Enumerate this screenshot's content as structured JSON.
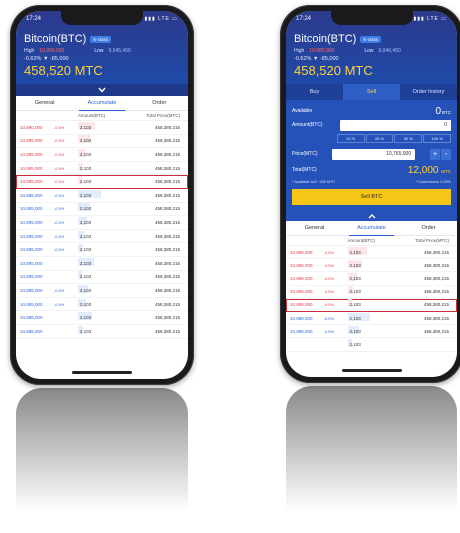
{
  "status": {
    "time": "17:24",
    "signal": "▮▮▮ LTE ▭"
  },
  "market": {
    "title": "Bitcoin(BTC)",
    "badge": "K-class",
    "high_label": "High",
    "low_label": "Low",
    "change": "-0.62% ▼ -85,000",
    "price": "458,520 MTC"
  },
  "left_phone": {
    "high_value": "10,990,000",
    "low_value": "9,945,450",
    "tabs": [
      "General",
      "Accumulate",
      "Order"
    ],
    "active_tab": 1,
    "columns": [
      "",
      "Amount(BTC)",
      "Total Price(MTC)"
    ],
    "rows": [
      {
        "side": "ask",
        "price": "10,890,000",
        "pct": "-0.5%",
        "amt": "2,103",
        "total": "458,380,215",
        "fill": 0.42
      },
      {
        "side": "ask",
        "price": "10,885,000",
        "pct": "-0.5%",
        "amt": "2,103",
        "total": "458,380,215",
        "fill": 0.3
      },
      {
        "side": "ask",
        "price": "10,885,000",
        "pct": "-0.5%",
        "amt": "2,103",
        "total": "458,380,215",
        "fill": 0.18
      },
      {
        "side": "ask",
        "price": "10,885,000",
        "pct": "-0.5%",
        "amt": "2,103",
        "total": "458,380,215",
        "fill": 0.12
      },
      {
        "side": "ask",
        "price": "10,885,000",
        "pct": "-0.5%",
        "amt": "2,103",
        "total": "458,380,215",
        "fill": 0.1,
        "selected": true
      },
      {
        "side": "bid",
        "price": "10,885,000",
        "pct": "-0.5%",
        "amt": "2,103",
        "total": "458,380,215",
        "fill": 0.55
      },
      {
        "side": "bid",
        "price": "10,885,000",
        "pct": "-0.5%",
        "amt": "2,103",
        "total": "458,380,215",
        "fill": 0.3
      },
      {
        "side": "bid",
        "price": "10,885,000",
        "pct": "-0.5%",
        "amt": "2,103",
        "total": "458,380,215",
        "fill": 0.22
      },
      {
        "side": "bid",
        "price": "10,885,000",
        "pct": "-0.5%",
        "amt": "2,103",
        "total": "458,380,215",
        "fill": 0.15
      },
      {
        "side": "bid",
        "price": "10,885,000",
        "pct": "-0.5%",
        "amt": "2,103",
        "total": "458,380,215",
        "fill": 0.12
      },
      {
        "side": "bid",
        "price": "10,885,000",
        "pct": "",
        "amt": "2,103",
        "total": "458,380,215",
        "fill": 0.4
      },
      {
        "side": "bid",
        "price": "10,885,000",
        "pct": "",
        "amt": "2,103",
        "total": "458,380,215",
        "fill": 0.1
      },
      {
        "side": "bid",
        "price": "10,885,000",
        "pct": "-0.5%",
        "amt": "2,103",
        "total": "458,380,215",
        "fill": 0.25
      },
      {
        "side": "bid",
        "price": "10,885,000",
        "pct": "-0.5%",
        "amt": "2,103",
        "total": "458,380,215",
        "fill": 0.2
      },
      {
        "side": "bid",
        "price": "10,885,000",
        "pct": "",
        "amt": "2,103",
        "total": "458,380,215",
        "fill": 0.35
      },
      {
        "side": "bid",
        "price": "10,885,000",
        "pct": "",
        "amt": "2,103",
        "total": "458,380,215",
        "fill": 0.12
      }
    ]
  },
  "right_phone": {
    "high_value": "10,880,000",
    "low_value": "9,946,450",
    "trade_tabs": [
      "Buy",
      "Sell",
      "Order history"
    ],
    "active_trade_tab": 1,
    "available_label": "Available",
    "available_value": "0",
    "available_unit": "BTC",
    "amount_label": "Amount(BTC)",
    "amount_value": "0",
    "percent_options": [
      "10 %",
      "25 %",
      "50 %",
      "100 %"
    ],
    "price_label": "Price(MTC)",
    "price_value": "10,765,000",
    "plus": "+",
    "minus": "-",
    "total_label": "Total(MTC)",
    "total_value": "12,000",
    "total_unit": "MTC",
    "note_left": "* Available sell : 000 MTC",
    "note_right": "* Commission 0.25%",
    "sell_button": "Sell BTC",
    "tabs": [
      "General",
      "Accumulate",
      "Order"
    ],
    "active_tab": 1,
    "columns": [
      "",
      "Amount(BTC)",
      "Total Price(MTC)"
    ],
    "rows": [
      {
        "side": "ask",
        "price": "10,886,000",
        "pct": "-0.5%",
        "amt": "2,103",
        "total": "458,380,215",
        "fill": 0.48
      },
      {
        "side": "ask",
        "price": "10,886,000",
        "pct": "-0.5%",
        "amt": "2,103",
        "total": "458,380,215",
        "fill": 0.35
      },
      {
        "side": "ask",
        "price": "10,886,000",
        "pct": "-0.5%",
        "amt": "2,103",
        "total": "458,380,215",
        "fill": 0.22
      },
      {
        "side": "ask",
        "price": "10,886,000",
        "pct": "-0.5%",
        "amt": "2,103",
        "total": "458,380,215",
        "fill": 0.14
      },
      {
        "side": "ask",
        "price": "10,886,000",
        "pct": "-0.5%",
        "amt": "2,103",
        "total": "458,380,215",
        "fill": 0.1,
        "selected": true
      },
      {
        "side": "bid",
        "price": "10,886,000",
        "pct": "-0.5%",
        "amt": "2,103",
        "total": "458,380,215",
        "fill": 0.55
      },
      {
        "side": "bid",
        "price": "10,886,000",
        "pct": "-0.5%",
        "amt": "2,103",
        "total": "458,380,215",
        "fill": 0.28
      },
      {
        "side": "bid",
        "price": "",
        "pct": "",
        "amt": "2,103",
        "total": "",
        "fill": 0.1
      }
    ]
  },
  "colors": {
    "header": "#2c3a8c",
    "accent": "#ffd23a",
    "ask": "#e0404a",
    "bid": "#2f6ad8"
  }
}
